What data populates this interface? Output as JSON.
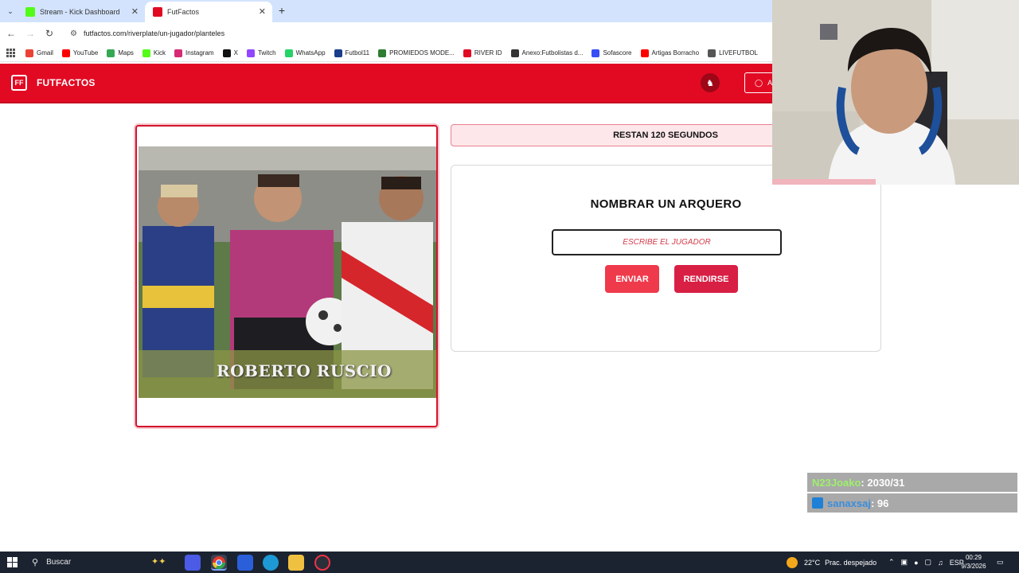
{
  "browser": {
    "tabs": [
      {
        "label": "Stream - Kick Dashboard",
        "favicon": "kick-icon",
        "active": false
      },
      {
        "label": "FutFactos",
        "favicon": "futfactos-icon",
        "active": true
      }
    ],
    "url": "futfactos.com/riverplate/un-jugador/planteles",
    "bookmarks": [
      {
        "label": "Gmail",
        "icon": "gmail-icon",
        "color": "#ea4335"
      },
      {
        "label": "YouTube",
        "icon": "youtube-icon",
        "color": "#ff0000"
      },
      {
        "label": "Maps",
        "icon": "maps-icon",
        "color": "#34a853"
      },
      {
        "label": "Kick",
        "icon": "kick-icon",
        "color": "#53fc18"
      },
      {
        "label": "Instagram",
        "icon": "instagram-icon",
        "color": "#d62976"
      },
      {
        "label": "X",
        "icon": "x-icon",
        "color": "#111111"
      },
      {
        "label": "Twitch",
        "icon": "twitch-icon",
        "color": "#9146ff"
      },
      {
        "label": "WhatsApp",
        "icon": "whatsapp-icon",
        "color": "#25d366"
      },
      {
        "label": "Futbol11",
        "icon": "futbol11-icon",
        "color": "#1a3e8c"
      },
      {
        "label": "PROMIEDOS MODE...",
        "icon": "promiedos-icon",
        "color": "#2e7d32"
      },
      {
        "label": "RIVER ID",
        "icon": "river-icon",
        "color": "#e20a23"
      },
      {
        "label": "Anexo:Futbolistas d...",
        "icon": "wikipedia-icon",
        "color": "#333333"
      },
      {
        "label": "Sofascore",
        "icon": "sofascore-icon",
        "color": "#374df5"
      },
      {
        "label": "Artigas Borracho",
        "icon": "youtube-icon",
        "color": "#ff0000"
      },
      {
        "label": "LIVEFUTBOL",
        "icon": "livefutbol-icon",
        "color": "#555555"
      }
    ]
  },
  "site": {
    "brand": "FUTFACTOS",
    "brand_color": "#e20a23",
    "login_label": "A"
  },
  "game": {
    "image_caption": "ROBERTO RUSCIO",
    "timer_text": "RESTAN 120 SEGUNDOS",
    "prompt": "NOMBRAR UN ARQUERO",
    "input_placeholder": "ESCRIBE EL JUGADOR",
    "input_value": "",
    "send_label": "ENVIAR",
    "give_up_label": "RENDIRSE"
  },
  "stream_overlay": {
    "chat": [
      {
        "user": "N23Joako",
        "text": ": 2030/31"
      },
      {
        "user": "sanaxsaj",
        "text": ": 96"
      }
    ]
  },
  "taskbar": {
    "search_placeholder": "Buscar",
    "weather": "22°C",
    "weather_desc": "Prac. despejado",
    "language": "ESP",
    "time": "00:29",
    "date": "9/3/2026"
  }
}
